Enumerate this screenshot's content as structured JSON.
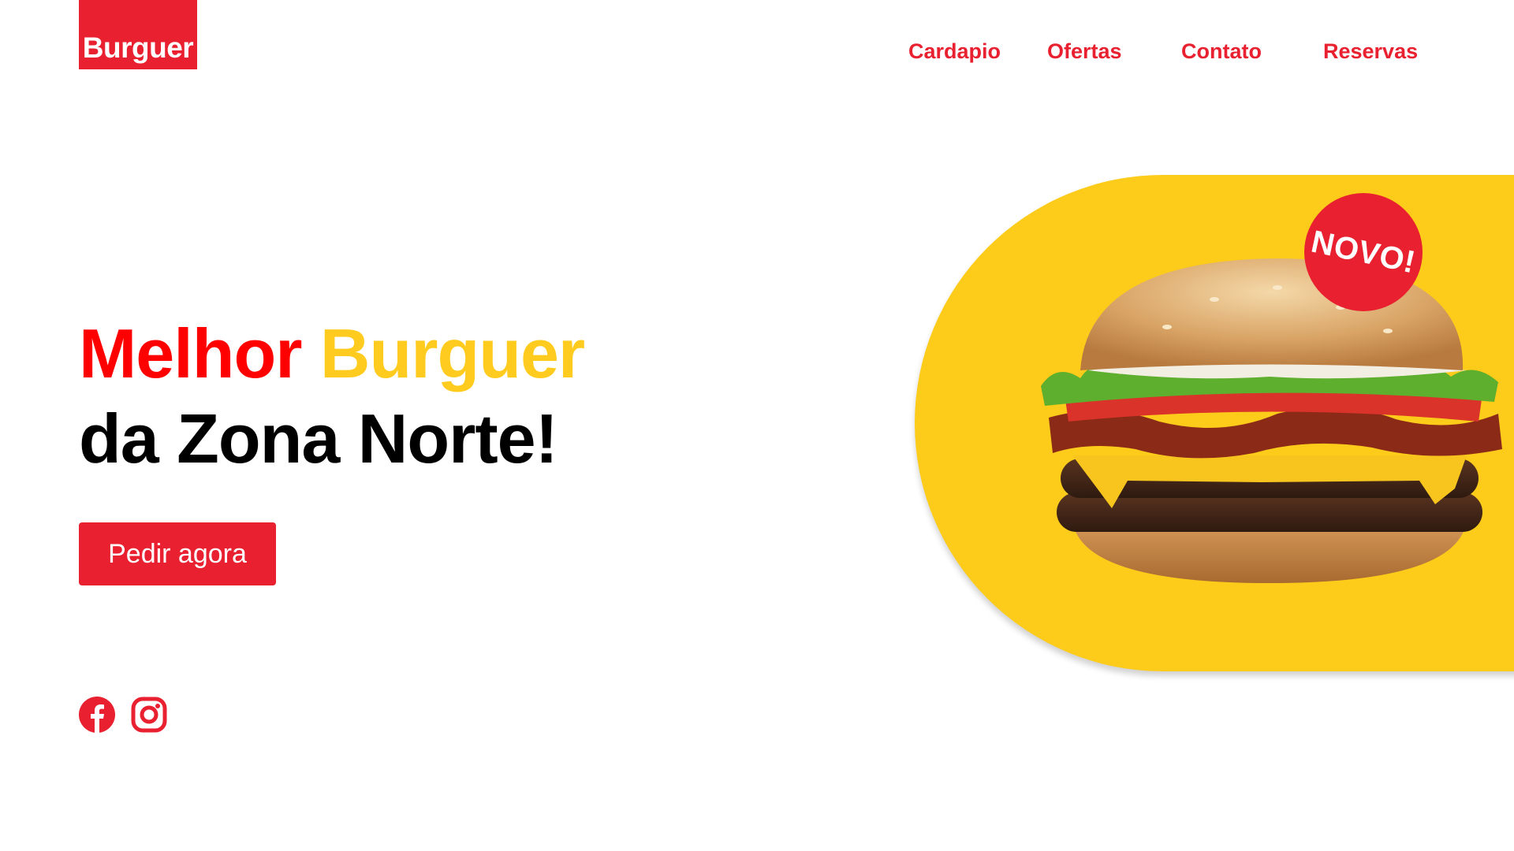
{
  "brand": {
    "logo_text": "Burguer",
    "primary_color": "#E8202F",
    "accent_color": "#FDCB1A"
  },
  "nav": {
    "items": [
      {
        "label": "Cardapio"
      },
      {
        "label": "Ofertas"
      },
      {
        "label": "Contato"
      },
      {
        "label": "Reservas"
      }
    ]
  },
  "hero": {
    "headline_part1": "Melhor",
    "headline_part2": "Burguer",
    "headline_line2": "da Zona Norte!",
    "cta_label": "Pedir agora"
  },
  "promo": {
    "badge_text": "NOVO!",
    "image_icon": "burger-image"
  },
  "social": {
    "icons": [
      "facebook-icon",
      "instagram-icon"
    ]
  }
}
